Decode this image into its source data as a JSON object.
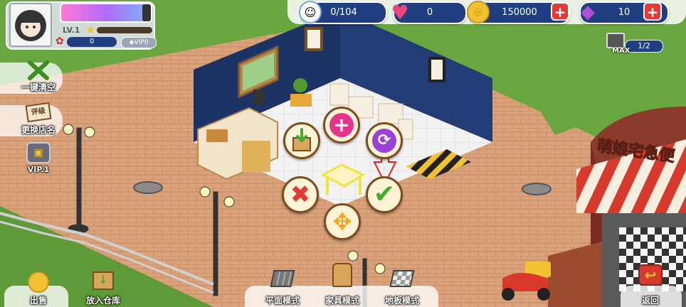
{
  "profile": {
    "level": "LV.1",
    "roses": "0",
    "vip_badge": "VIP0"
  },
  "resources": {
    "visitors": "0/104",
    "hearts": "0",
    "coins": "150000",
    "gems": "10"
  },
  "upgrade": {
    "max_label": "MAX",
    "count": "1/2"
  },
  "side_menu": {
    "clear_all": "一键清空",
    "rename_shop": "更换店名",
    "rename_sign": "评级",
    "vip": "VIP.1"
  },
  "bottom_bar": {
    "sell": "出售",
    "store": "放入仓库",
    "flat_mode": "平面模式",
    "furniture_mode": "家具模式",
    "floor_mode": "地板模式",
    "back": "返回"
  },
  "shop_sign": "萌娘宅急便",
  "colors": {
    "hud_pill": "#1f3f80",
    "coin": "#f2c230",
    "gem": "#b04fd6",
    "heart": "#f0457a",
    "confirm_green": "#3fae2a",
    "cancel_red": "#e53935"
  }
}
